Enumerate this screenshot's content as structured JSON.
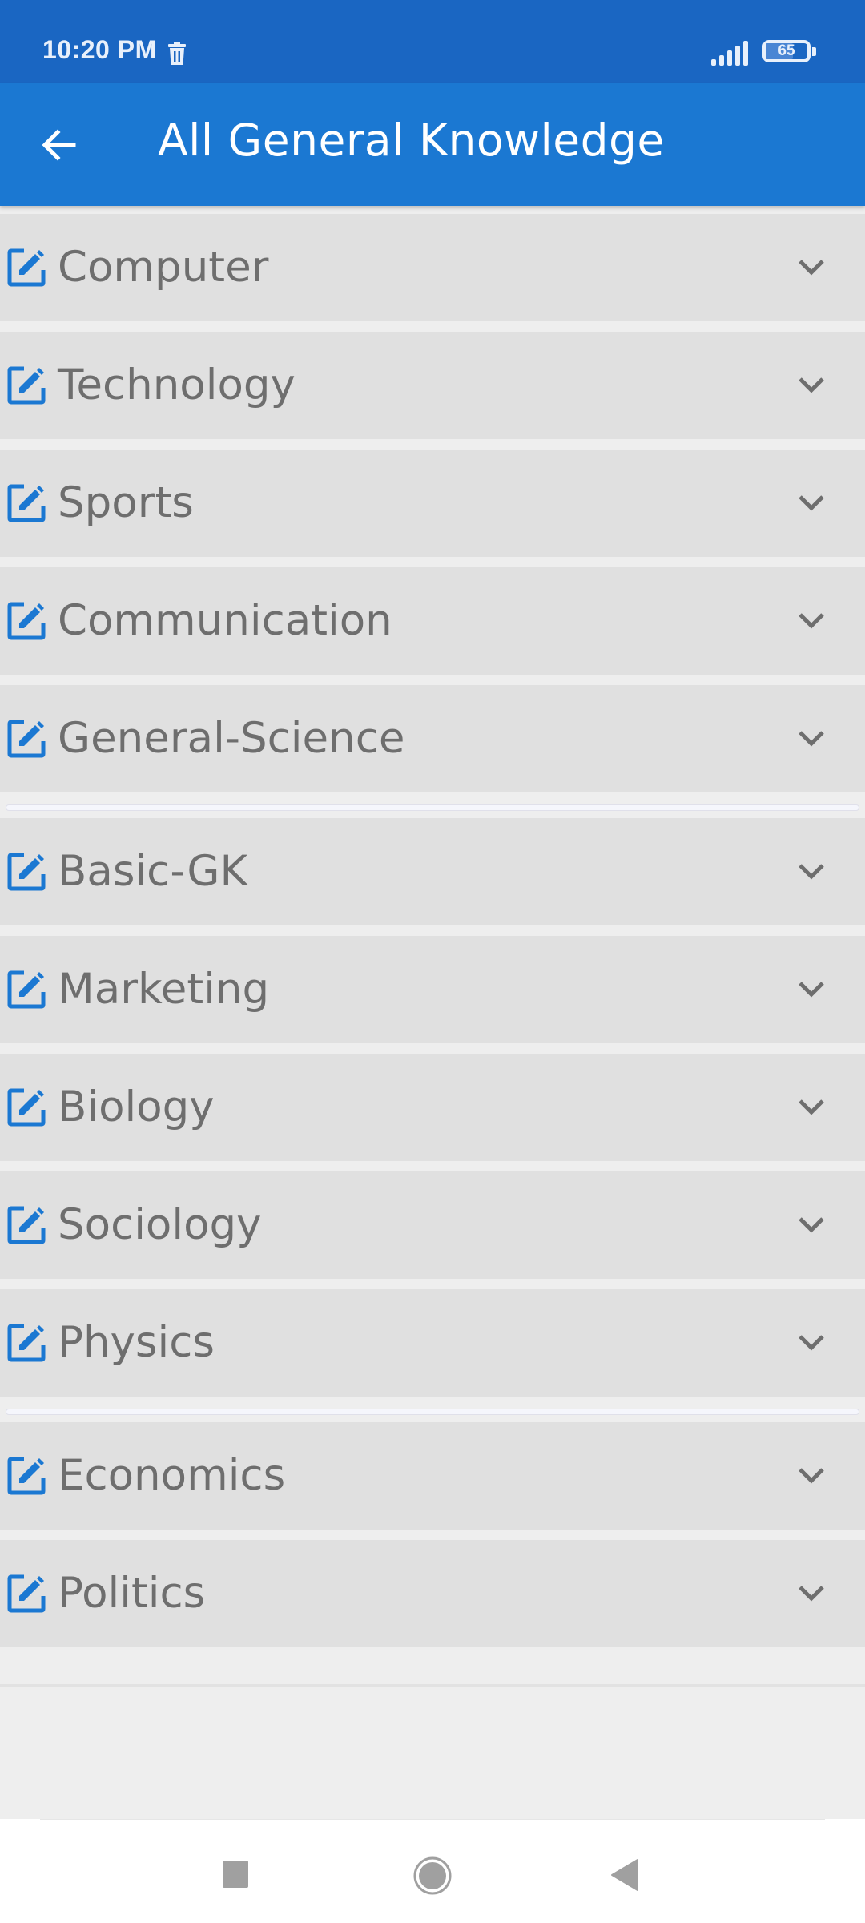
{
  "status_bar": {
    "time": "10:20 PM",
    "notification_icon": "trash-icon",
    "signal_icon": "signal-bars-icon",
    "battery_level": "65",
    "battery_fraction": 0.65
  },
  "app_bar": {
    "back_icon": "arrow-left-icon",
    "title": "All General Knowledge"
  },
  "colors": {
    "status_bar": "#1a66c2",
    "app_bar": "#1b78d2",
    "accent_icon": "#1b78d2",
    "row_bg": "#e0e0e0",
    "row_text": "#6e6e6e",
    "page_bg": "#eeeeee"
  },
  "categories": [
    {
      "label": "Computer",
      "icon": "edit-icon",
      "expand_icon": "chevron-down-icon"
    },
    {
      "label": "Technology",
      "icon": "edit-icon",
      "expand_icon": "chevron-down-icon"
    },
    {
      "label": "Sports",
      "icon": "edit-icon",
      "expand_icon": "chevron-down-icon"
    },
    {
      "label": "Communication",
      "icon": "edit-icon",
      "expand_icon": "chevron-down-icon"
    },
    {
      "label": "General-Science",
      "icon": "edit-icon",
      "expand_icon": "chevron-down-icon"
    },
    {
      "label": "Basic-GK",
      "icon": "edit-icon",
      "expand_icon": "chevron-down-icon"
    },
    {
      "label": "Marketing",
      "icon": "edit-icon",
      "expand_icon": "chevron-down-icon"
    },
    {
      "label": "Biology",
      "icon": "edit-icon",
      "expand_icon": "chevron-down-icon"
    },
    {
      "label": "Sociology",
      "icon": "edit-icon",
      "expand_icon": "chevron-down-icon"
    },
    {
      "label": "Physics",
      "icon": "edit-icon",
      "expand_icon": "chevron-down-icon"
    },
    {
      "label": "Economics",
      "icon": "edit-icon",
      "expand_icon": "chevron-down-icon"
    },
    {
      "label": "Politics",
      "icon": "edit-icon",
      "expand_icon": "chevron-down-icon"
    }
  ],
  "nav_bar": {
    "recent_icon": "square-recents-icon",
    "home_icon": "circle-home-icon",
    "back_icon": "triangle-back-icon"
  }
}
